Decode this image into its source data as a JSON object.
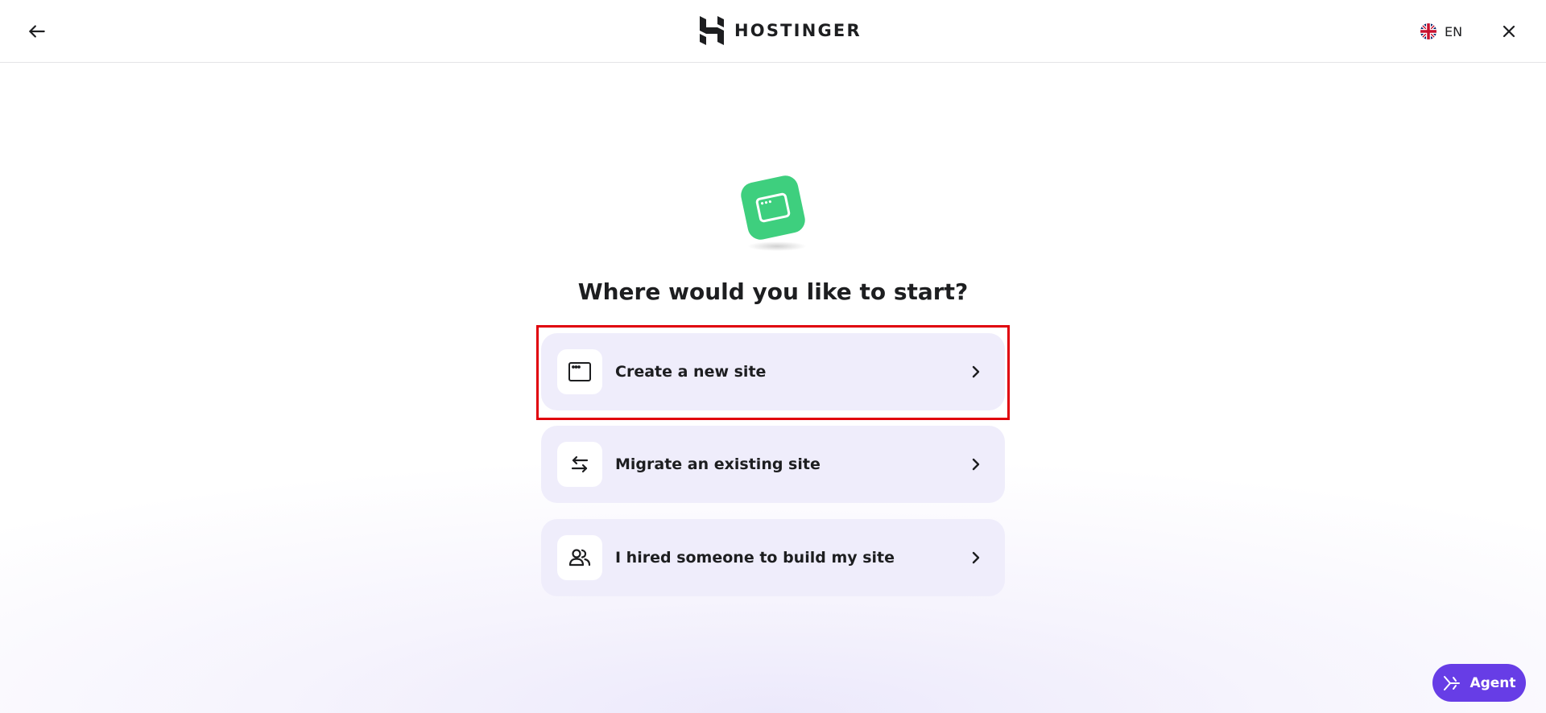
{
  "header": {
    "brand": "HOSTINGER",
    "language": "EN",
    "back_icon": "arrow-left-icon",
    "close_icon": "close-icon",
    "flag_icon": "uk-flag-icon"
  },
  "main": {
    "hero_icon": "browser-window-icon",
    "title": "Where would you like to start?",
    "options": [
      {
        "label": "Create a new site",
        "icon": "browser-window-icon",
        "selected": true
      },
      {
        "label": "Migrate an existing site",
        "icon": "arrows-swap-icon",
        "selected": false
      },
      {
        "label": "I hired someone to build my site",
        "icon": "people-icon",
        "selected": false
      }
    ]
  },
  "agent": {
    "label": "Agent",
    "icon": "agent-sparkle-icon"
  },
  "colors": {
    "accent": "#673de6",
    "hero_green": "#3ecf7e",
    "option_bg": "#efedfb",
    "highlight": "#e0000b"
  }
}
